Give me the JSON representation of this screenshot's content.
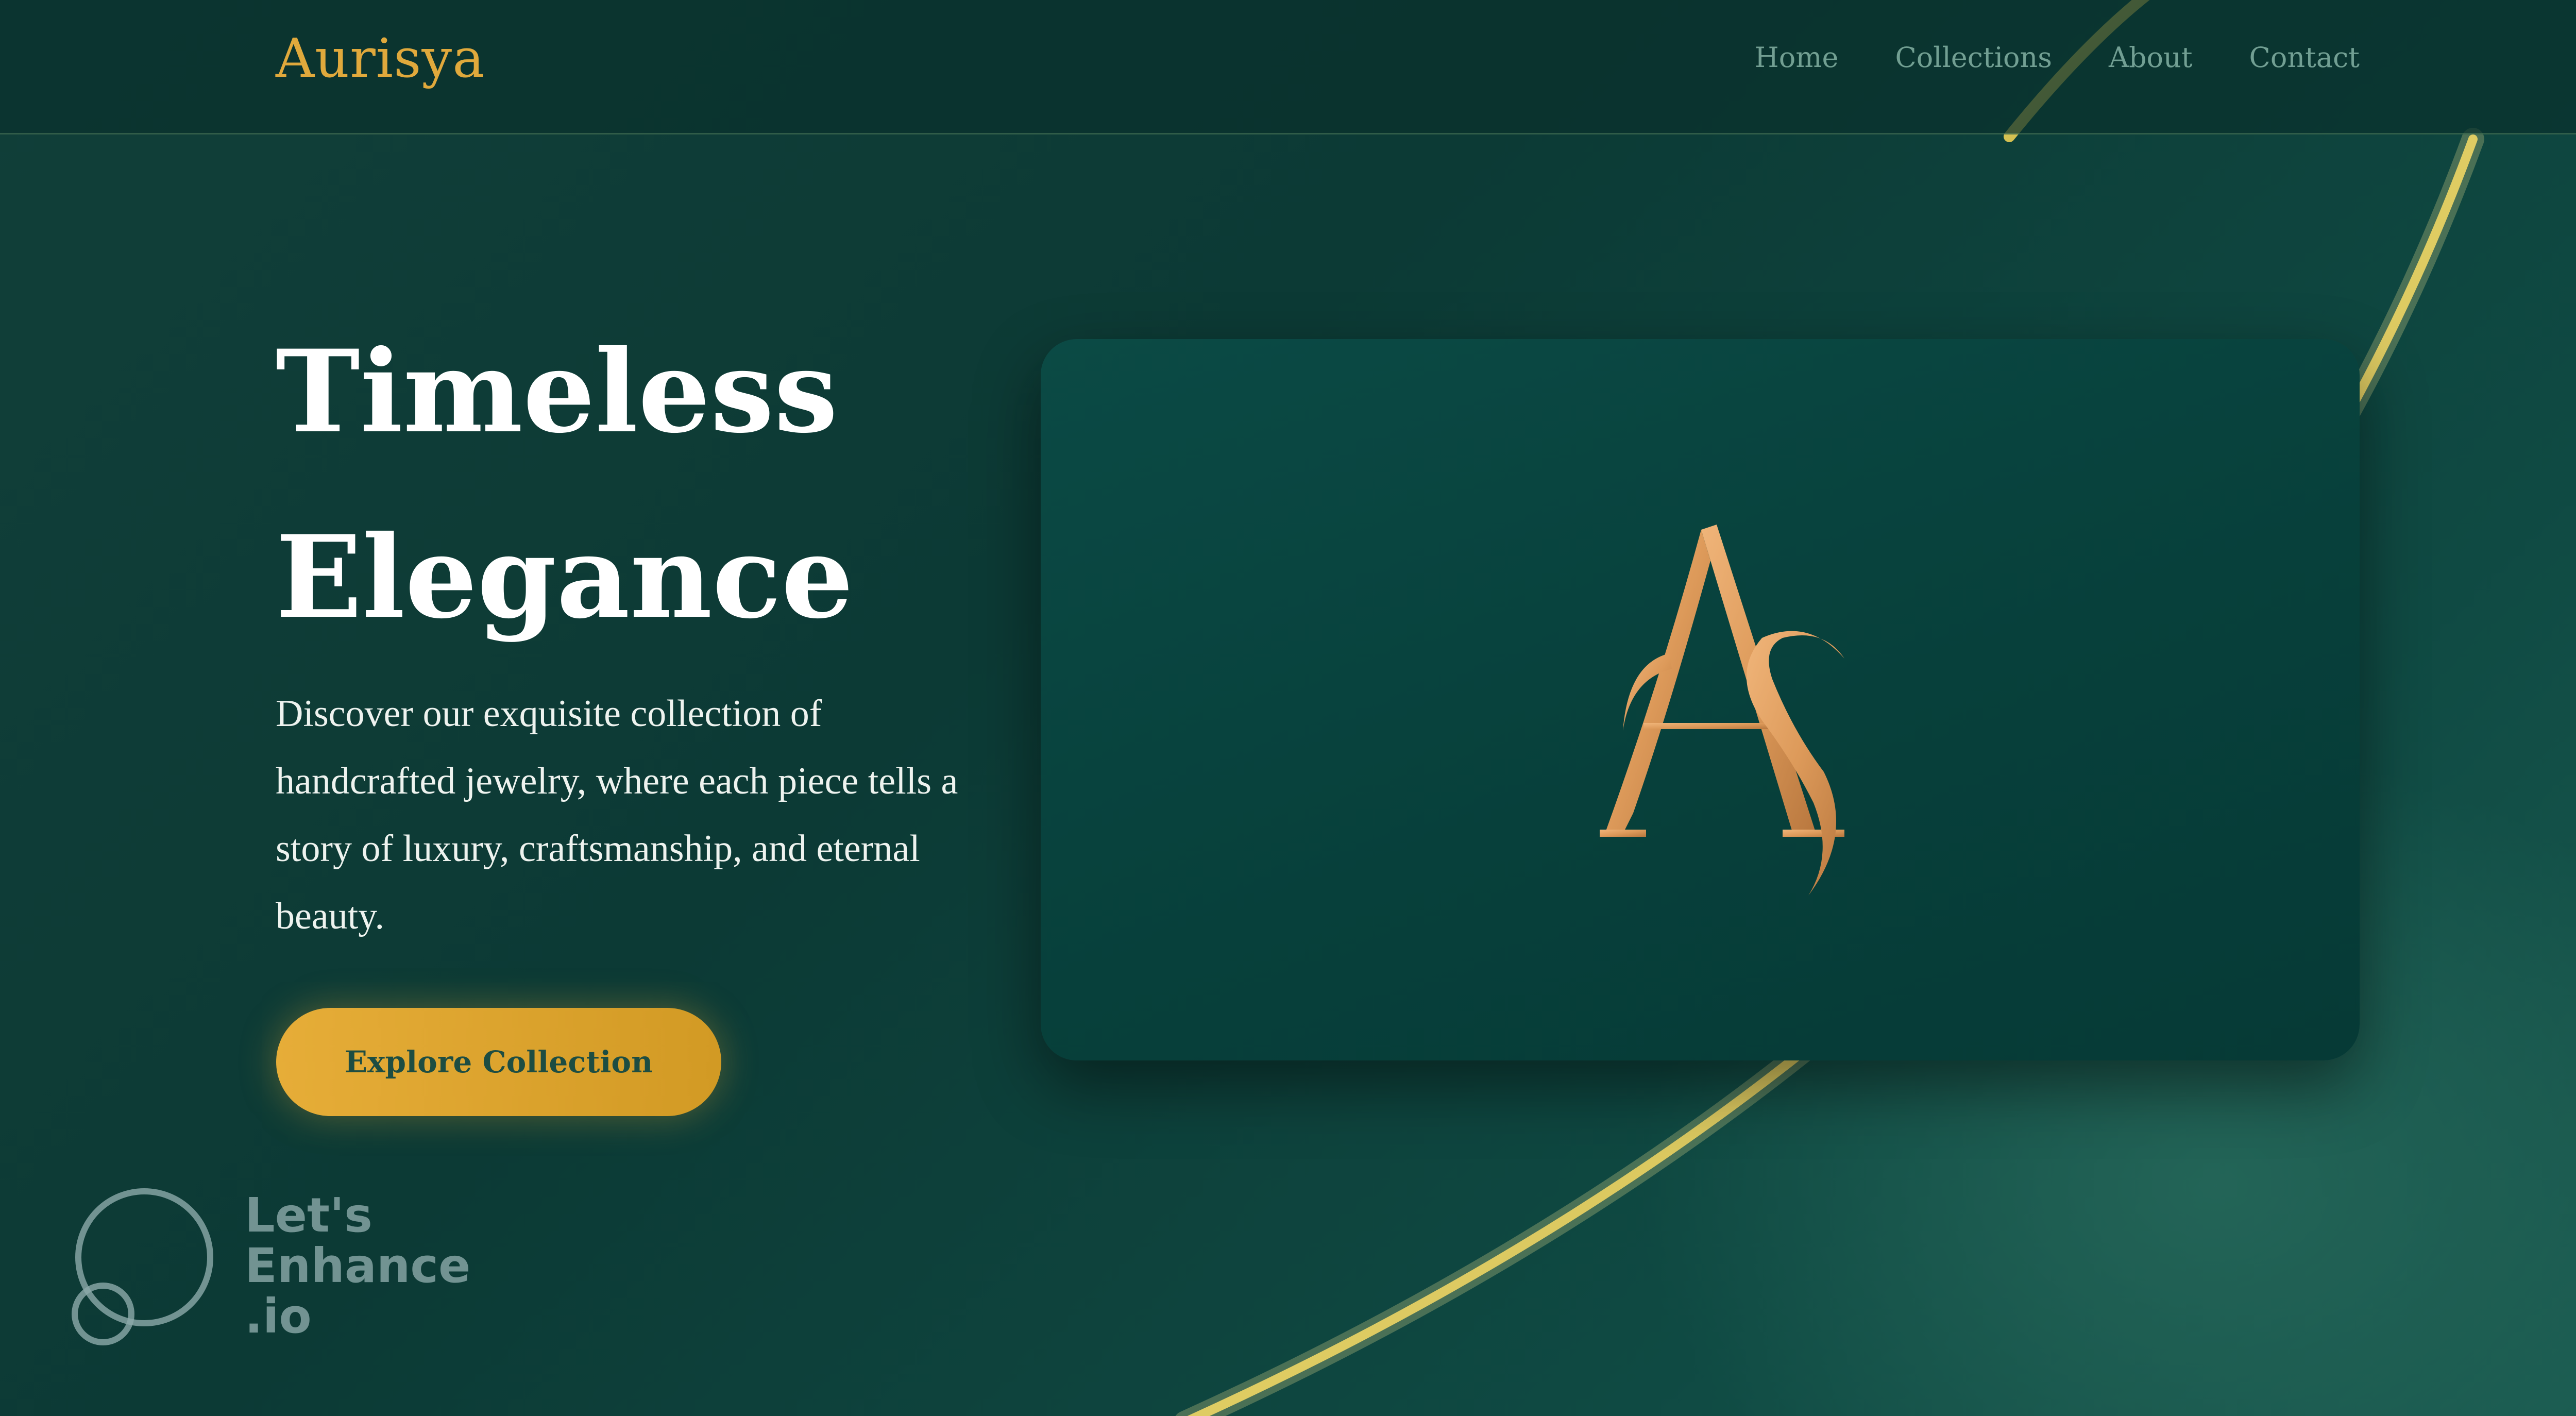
{
  "header": {
    "brand": "Aurisya",
    "nav": [
      {
        "label": "Home"
      },
      {
        "label": "Collections"
      },
      {
        "label": "About"
      },
      {
        "label": "Contact"
      }
    ]
  },
  "hero": {
    "title_line1": "Timeless",
    "title_line2": "Elegance",
    "description": "Discover our exquisite collection of handcrafted jewelry, where each piece tells a story of luxury, craftsmanship, and eternal beauty.",
    "cta_label": "Explore Collection"
  },
  "showcase": {
    "logo": "monogram-icon"
  },
  "watermark": {
    "lines": [
      "Let's",
      "Enhance",
      ".io"
    ]
  },
  "colors": {
    "background": "#0d3b36",
    "gold_accent": "#e0a93c",
    "button": "#e6ad38",
    "card": "#07403b",
    "monogram": "#e3a266"
  }
}
